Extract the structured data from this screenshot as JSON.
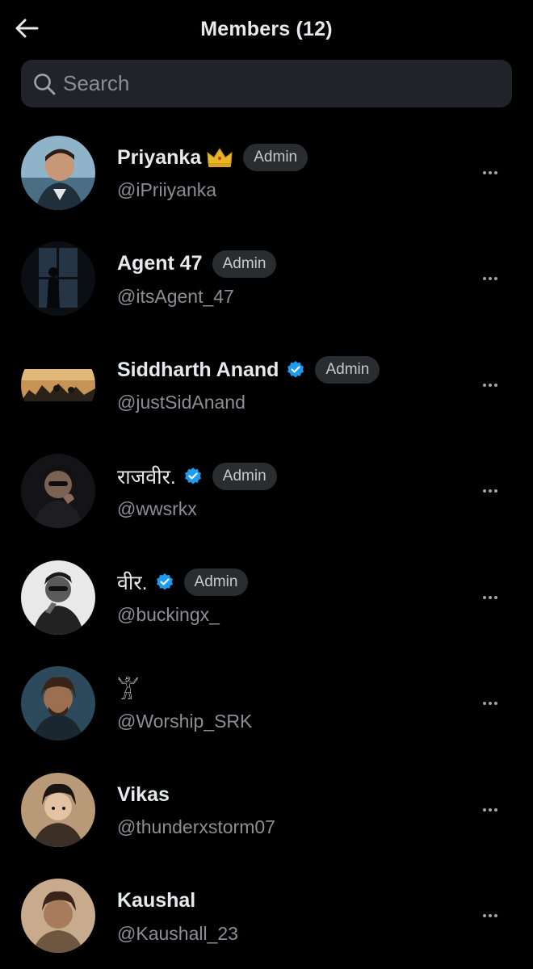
{
  "header": {
    "title": "Members (12)",
    "back_icon": "arrow-left-icon"
  },
  "search": {
    "placeholder": "Search",
    "value": ""
  },
  "admin_label": "Admin",
  "members": [
    {
      "name": "Priyanka",
      "handle": "@iPriiyanka",
      "admin": true,
      "crown": true,
      "verified": false
    },
    {
      "name": "Agent 47",
      "handle": "@itsAgent_47",
      "admin": true,
      "crown": false,
      "verified": false
    },
    {
      "name": "Siddharth Anand",
      "handle": "@justSidAnand",
      "admin": true,
      "crown": false,
      "verified": true
    },
    {
      "name": "राजवीर.",
      "handle": "@wwsrkx",
      "admin": true,
      "crown": false,
      "verified": true
    },
    {
      "name": "वीर.",
      "handle": "@buckingx_",
      "admin": true,
      "crown": false,
      "verified": true
    },
    {
      "name": "𓀠",
      "handle": "@Worship_SRK",
      "admin": false,
      "crown": false,
      "verified": false
    },
    {
      "name": "Vikas",
      "handle": "@thunderxstorm07",
      "admin": false,
      "crown": false,
      "verified": false
    },
    {
      "name": "Kaushal",
      "handle": "@Kaushall_23",
      "admin": false,
      "crown": false,
      "verified": false
    }
  ],
  "colors": {
    "background": "#000000",
    "verified_blue": "#1d9bf0",
    "crown_gold": "#e8b526",
    "badge_bg": "#2a2d30"
  }
}
